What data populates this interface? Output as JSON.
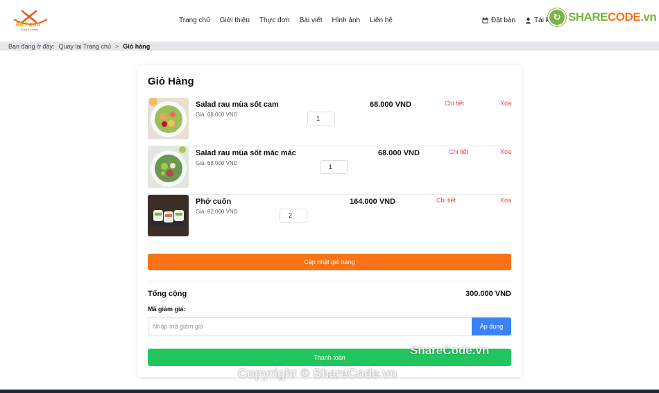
{
  "header": {
    "logo_text": "All Food",
    "logo_sub": "Food & Drinks",
    "nav": [
      "Trang chủ",
      "Giới thiệu",
      "Thực đơn",
      "Bài viết",
      "Hình ảnh",
      "Liên hệ"
    ],
    "booking": "Đặt bàn",
    "account": "Tài khoản"
  },
  "watermark": {
    "brand_green": "SHARE",
    "brand_orange": "CODE",
    "brand_suffix": ".vn",
    "overlay1": "ShareCode.vn",
    "overlay2": "Copyright © ShareCode.vn"
  },
  "breadcrumb": {
    "prefix": "Bạn đang ở đây:",
    "home": "Quay lại Trang chủ",
    "sep": ">",
    "current": "Giỏ hàng"
  },
  "cart": {
    "title": "Giỏ Hàng",
    "items": [
      {
        "name": "Salad rau mùa sốt cam",
        "price": "Giá: 68.000 VND",
        "qty": "1",
        "total": "68.000 VND",
        "detail": "Chi tiết",
        "remove": "Xóa"
      },
      {
        "name": "Salad rau mùa sốt mác mác",
        "price": "Giá: 68.000 VND",
        "qty": "1",
        "total": "68.000 VND",
        "detail": "Chi tiết",
        "remove": "Xóa"
      },
      {
        "name": "Phở cuốn",
        "price": "Giá: 82.000 VND",
        "qty": "2",
        "total": "164.000 VND",
        "detail": "Chi tiết",
        "remove": "Xóa"
      }
    ],
    "update_label": "Cập nhật giỏ hàng",
    "total_label": "Tổng cộng",
    "total_value": "300.000 VND",
    "coupon_label": "Mã giảm giá:",
    "coupon_placeholder": "Nhập mã giảm giá",
    "apply_label": "Áp dụng",
    "checkout_label": "Thanh toán"
  },
  "colors": {
    "accent_orange": "#f97316",
    "accent_blue": "#3b82f6",
    "accent_green": "#22c55e",
    "link_red": "#ef4444"
  }
}
